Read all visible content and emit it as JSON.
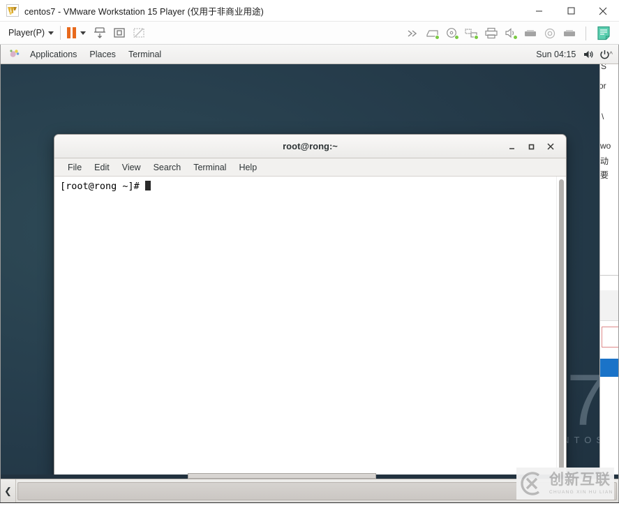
{
  "vmware": {
    "window_title": "centos7 - VMware Workstation 15 Player (仅用于非商业用途)",
    "app_icon": "vmware-logo-icon",
    "window_controls": {
      "minimize": "minimize-icon",
      "maximize": "maximize-icon",
      "close": "close-icon"
    },
    "toolbar": {
      "player_menu_label": "Player(P)",
      "pause_label": "pause-button",
      "icons": [
        "chevron-double-right-icon",
        "hard-disk-icon",
        "cd-dvd-icon",
        "network-adapter-icon",
        "printer-icon",
        "sound-card-icon",
        "usb-device-icon",
        "camera-icon",
        "usb-device-2-icon",
        "notes-icon"
      ],
      "left_icons": [
        "send-ctrl-alt-del-icon",
        "fullscreen-icon",
        "unity-mode-icon"
      ]
    }
  },
  "gnome": {
    "panel": {
      "applications_label": "Applications",
      "places_label": "Places",
      "terminal_label": "Terminal",
      "apps_icon": "gnome-foot-icon",
      "clock": "Sun 04:15",
      "volume_icon": "volume-icon",
      "power_icon": "power-icon",
      "expand_caret": "^"
    },
    "taskbar": {
      "left_arrow": "❮",
      "window_button_label": ""
    }
  },
  "desktop": {
    "wallpaper_number": "7",
    "wallpaper_word": "NTOS"
  },
  "terminal": {
    "title": "root@rong:~",
    "controls": {
      "minimize": "minimize-icon",
      "maximize": "maximize-icon",
      "close": "close-icon"
    },
    "menu": [
      {
        "label": "File"
      },
      {
        "label": "Edit"
      },
      {
        "label": "View"
      },
      {
        "label": "Search"
      },
      {
        "label": "Terminal"
      },
      {
        "label": "Help"
      }
    ],
    "prompt": "[root@rong ~]# ",
    "lines": [],
    "cursor": "block-cursor"
  },
  "background_window": {
    "fragments": [
      "S",
      "or",
      "\\",
      "wo",
      "动",
      "要"
    ]
  },
  "watermark": {
    "chinese": "创新互联",
    "pinyin": "CHUANG XIN HU LIAN",
    "mark_icon": "cx-logo-icon"
  },
  "colors": {
    "vmware_accent": "#e8691c",
    "desktop_bg": "#27404e",
    "terminal_bg": "#ffffff",
    "terminal_fg": "#000000",
    "panel_bg": "#f2f1ef",
    "device_active": "#7ac943"
  }
}
